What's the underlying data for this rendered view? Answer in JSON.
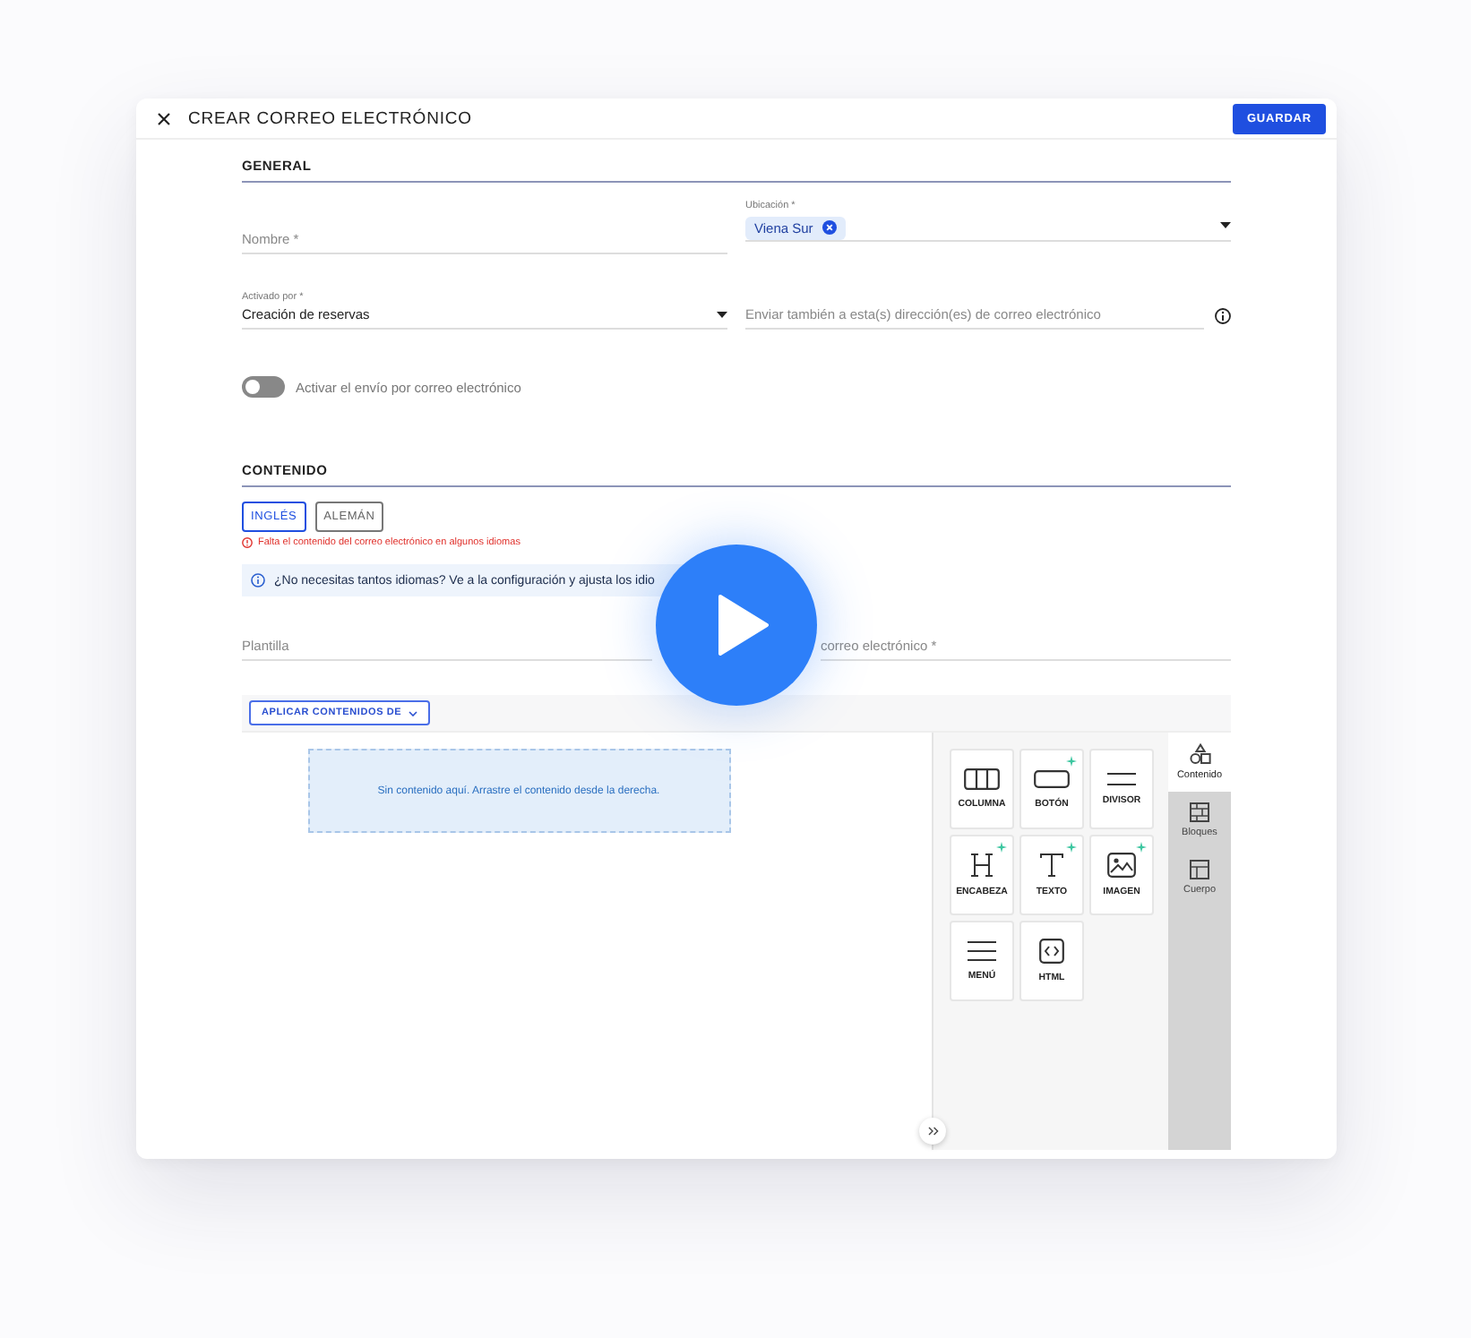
{
  "window": {
    "title": "CREAR CORREO ELECTRÓNICO",
    "save_button": "GUARDAR"
  },
  "general": {
    "heading": "GENERAL",
    "name_field": {
      "placeholder": "Nombre *"
    },
    "location_field": {
      "label": "Ubicación *",
      "chips": [
        "Viena Sur"
      ]
    },
    "trigger_field": {
      "label": "Activado por *",
      "value": "Creación de reservas"
    },
    "cc_field": {
      "placeholder": "Enviar también a esta(s) dirección(es) de correo electrónico"
    },
    "toggle": {
      "label": "Activar el envío por correo electrónico",
      "on": false
    }
  },
  "content": {
    "heading": "CONTENIDO",
    "languages": [
      {
        "label": "INGLÉS",
        "selected": true
      },
      {
        "label": "ALEMÁN",
        "selected": false
      }
    ],
    "error": "Falta el contenido del correo electrónico en algunos idiomas",
    "info": "¿No necesitas tantos idiomas? Ve a la configuración y ajusta los idio",
    "template_field": {
      "placeholder": "Plantilla"
    },
    "subject_field": {
      "placeholder": "correo electrónico *"
    }
  },
  "editor": {
    "apply_button": "APLICAR CONTENIDOS DE",
    "empty_message": "Sin contenido aquí. Arrastre el contenido desde la derecha.",
    "tiles": [
      {
        "kind": "columns",
        "label": "COLUMNA",
        "sparkle": false
      },
      {
        "kind": "button",
        "label": "BOTÓN",
        "sparkle": true
      },
      {
        "kind": "divider",
        "label": "DIVISOR",
        "sparkle": false
      },
      {
        "kind": "heading",
        "label": "ENCABEZA",
        "sparkle": true
      },
      {
        "kind": "text",
        "label": "TEXTO",
        "sparkle": true
      },
      {
        "kind": "image",
        "label": "IMAGEN",
        "sparkle": true
      },
      {
        "kind": "menu",
        "label": "MENÚ",
        "sparkle": false
      },
      {
        "kind": "html",
        "label": "HTML",
        "sparkle": false
      }
    ],
    "side_tabs": [
      {
        "kind": "content",
        "label": "Contenido",
        "selected": true
      },
      {
        "kind": "blocks",
        "label": "Bloques",
        "selected": false
      },
      {
        "kind": "body",
        "label": "Cuerpo",
        "selected": false
      }
    ]
  }
}
